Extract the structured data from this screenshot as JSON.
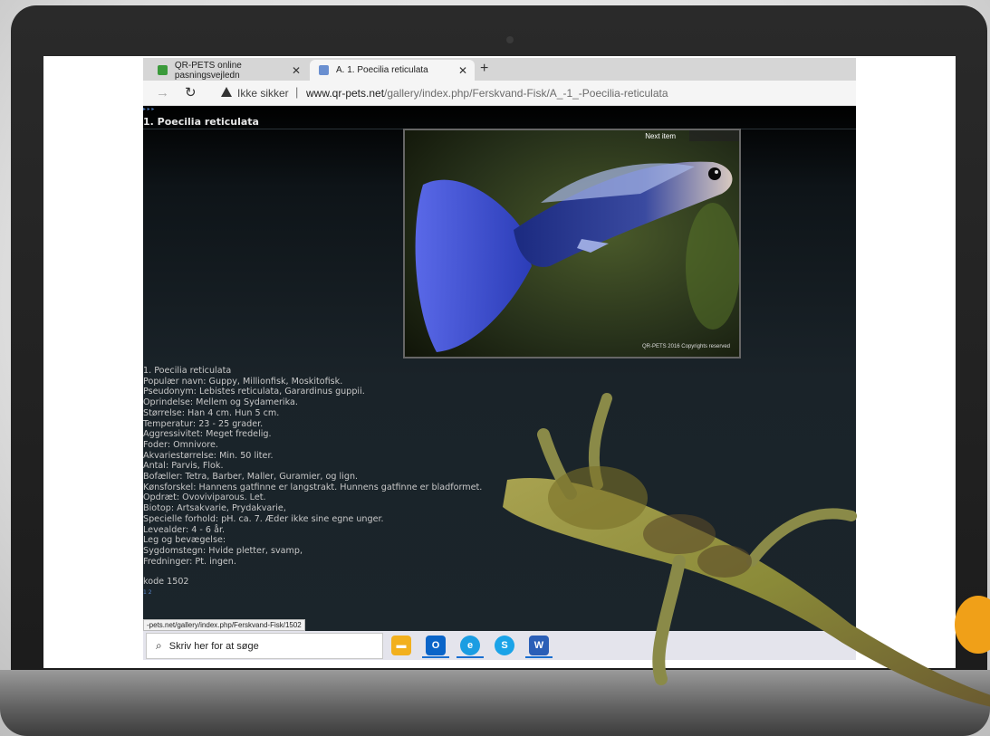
{
  "browser": {
    "tabs": [
      {
        "label": "QR-PETS online pasningsvejledn"
      },
      {
        "label": "A. 1. Poecilia reticulata"
      }
    ],
    "new_tab": "+",
    "security_label": "Ikke sikker",
    "url_host": "www.qr-pets.net",
    "url_path": "/gallery/index.php/Ferskvand-Fisk/A_-1_-Poecilia-reticulata"
  },
  "page": {
    "title": "1. Poecilia reticulata",
    "next_item": "Next item",
    "photo_copyright": "QR-PETS 2016 Copyrights reserved",
    "info_lines": [
      "1. Poecilia reticulata",
      "Populær navn: Guppy, Millionfisk, Moskitofisk.",
      "Pseudonym: Lebistes reticulata, Garardinus guppii.",
      "Oprindelse: Mellem og Sydamerika.",
      "Størrelse: Han 4 cm. Hun 5 cm.",
      "Temperatur: 23 - 25 grader.",
      "Aggressivitet: Meget fredelig.",
      "Foder: Omnivore.",
      "Akvariestørrelse: Min. 50 liter.",
      "Antal: Parvis, Flok.",
      " Bofæller: Tetra, Barber, Maller, Guramier, og lign.",
      " Kønsforskel: Hannens gatfinne er langstrakt. Hunnens gatfinne er bladformet.",
      " Opdræt: Ovoviviparous. Let.",
      " Biotop: Artsakvarie, Prydakvarie,",
      " Specielle forhold: pH. ca. 7. Æder ikke sine egne unger.",
      " Levealder: 4 - 6 år.",
      " Leg og bevægelse:",
      " Sygdomstegn: Hvide pletter, svamp,",
      " Fredninger: Pt. ingen."
    ],
    "code": "kode 1502",
    "pager": "1 2",
    "status_url": "-pets.net/gallery/index.php/Ferskvand-Fisk/1502"
  },
  "taskbar": {
    "search_placeholder": "Skriv her for at søge",
    "apps": [
      {
        "icon": "file-explorer-icon",
        "color": "#f2b01e"
      },
      {
        "icon": "outlook-icon",
        "color": "#0a64c8"
      },
      {
        "icon": "edge-icon",
        "color": "#1b9de2"
      },
      {
        "icon": "skype-icon",
        "color": "#1aa3e8"
      },
      {
        "icon": "word-icon",
        "color": "#2b5fb7"
      }
    ]
  }
}
